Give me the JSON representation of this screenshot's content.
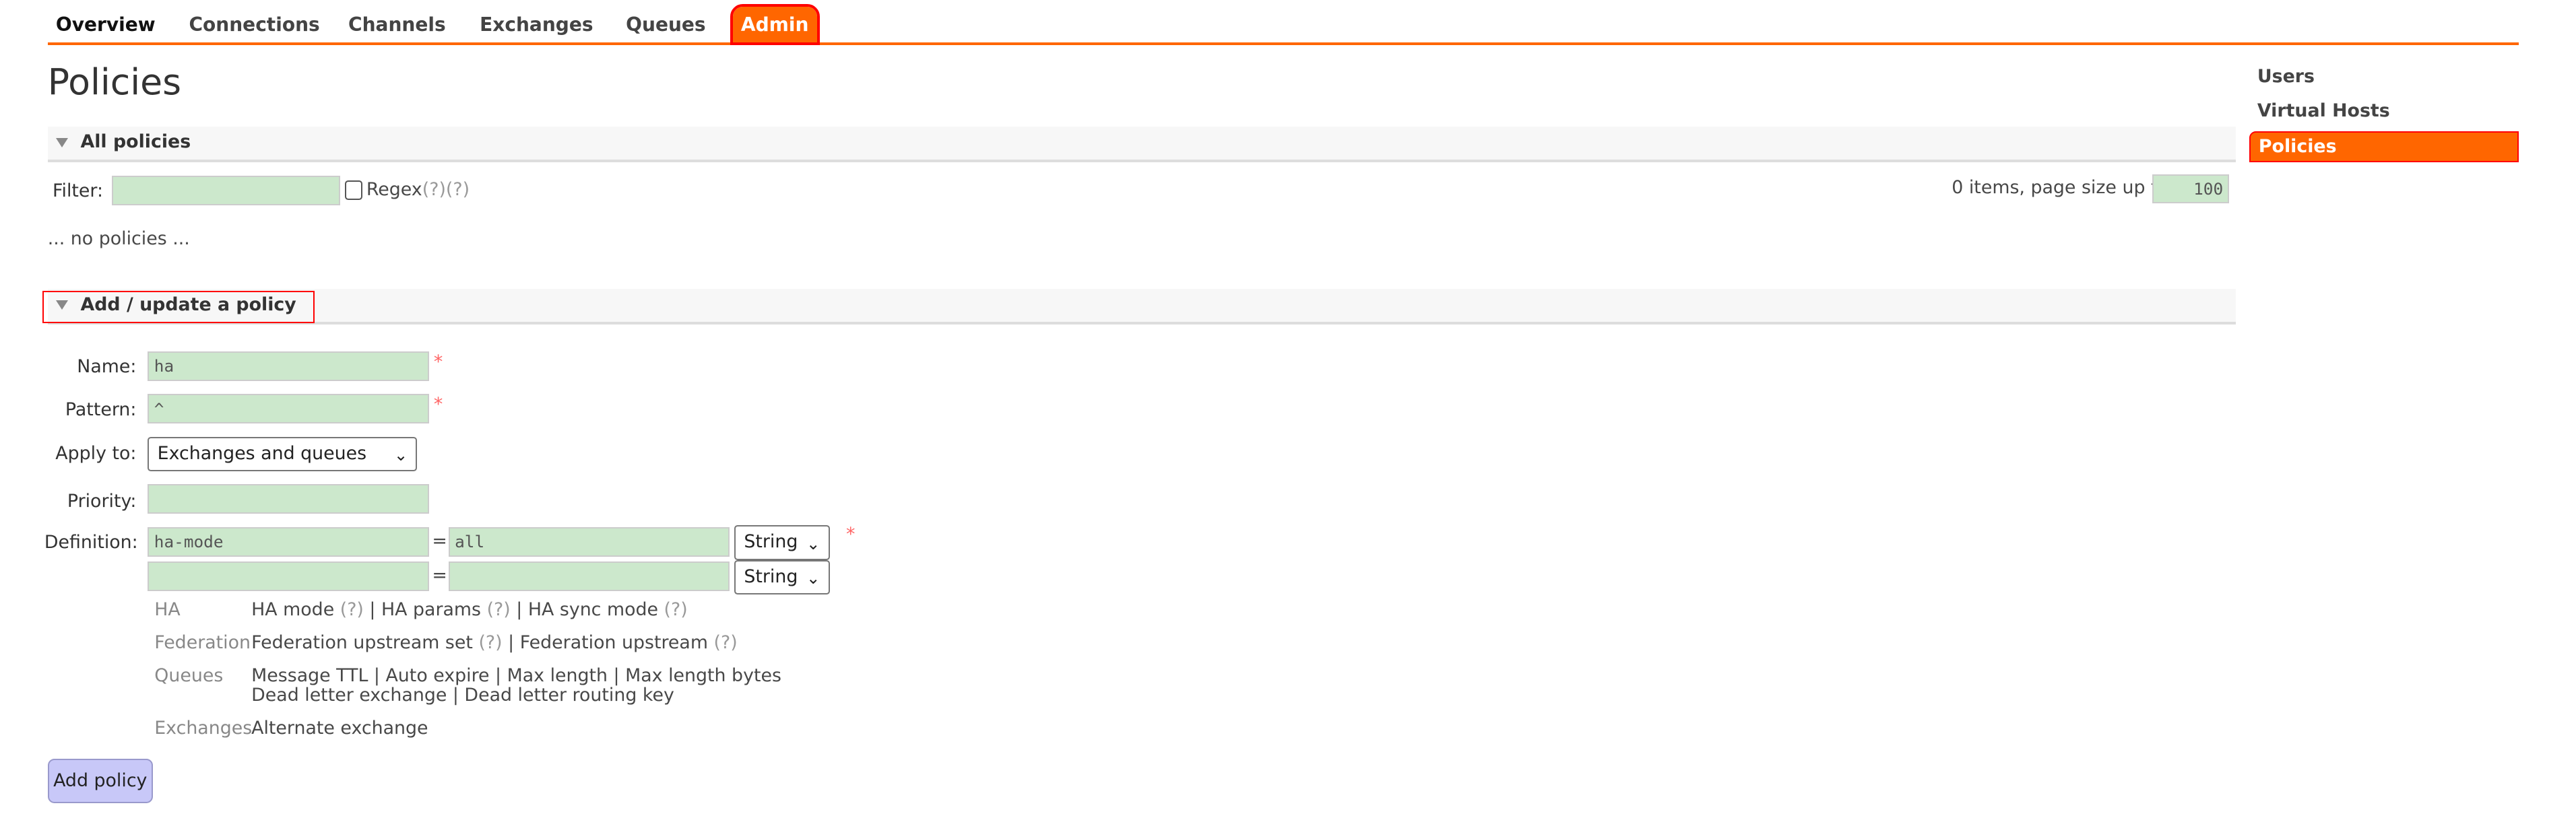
{
  "nav": {
    "tabs": [
      "Overview",
      "Connections",
      "Channels",
      "Exchanges",
      "Queues",
      "Admin"
    ],
    "active": "Admin"
  },
  "page_title": "Policies",
  "all_policies": {
    "title": "All policies",
    "filter_label": "Filter:",
    "filter_value": "",
    "regex_label": "Regex",
    "regex_help": "(?)(?)",
    "items_text": "0 items, page size up to",
    "page_size": "100",
    "empty_text": "... no policies ..."
  },
  "add_policy": {
    "title": "Add / update a policy",
    "name_label": "Name:",
    "name_value": "ha",
    "pattern_label": "Pattern:",
    "pattern_value": "^",
    "apply_label": "Apply to:",
    "apply_value": "Exchanges and queues",
    "priority_label": "Priority:",
    "priority_value": "",
    "definition_label": "Definition:",
    "definitions": [
      {
        "key": "ha-mode",
        "value": "all",
        "type": "String"
      },
      {
        "key": "",
        "value": "",
        "type": "String"
      }
    ],
    "equals": "=",
    "required": "*",
    "help": [
      {
        "category": "HA",
        "items": "HA mode",
        "q": "(?)",
        "sep": "|",
        "items2": "HA params",
        "items3": "HA sync mode"
      },
      {
        "category": "Federation",
        "items": "Federation upstream set",
        "items2": "Federation upstream"
      },
      {
        "category": "Queues",
        "line1": "Message TTL | Auto expire | Max length | Max length bytes",
        "line2": "Dead letter exchange | Dead letter routing key"
      },
      {
        "category": "Exchanges",
        "items": "Alternate exchange"
      }
    ],
    "submit": "Add policy"
  },
  "sidebar": {
    "items": [
      "Users",
      "Virtual Hosts",
      "Policies"
    ],
    "active": "Policies"
  },
  "colors": {
    "accent": "#ff6600",
    "input_bg": "#cce8cc",
    "button_bg": "#c8c8f8",
    "highlight": "#ff0000"
  }
}
